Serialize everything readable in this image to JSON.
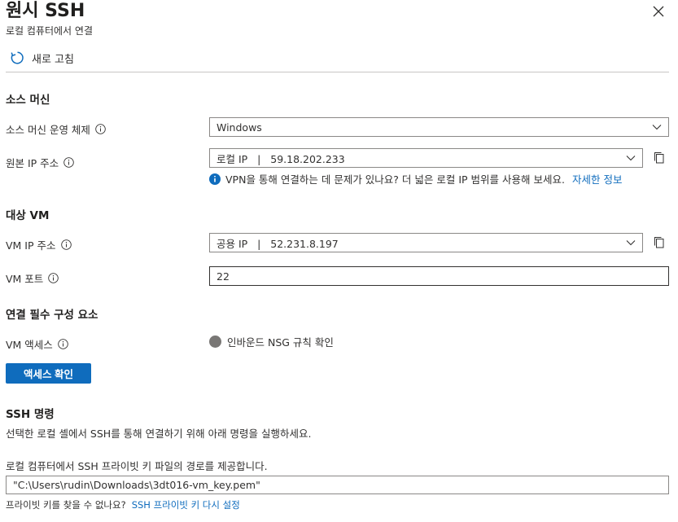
{
  "header": {
    "title": "원시 SSH",
    "subtitle": "로컬 컴퓨터에서 연결",
    "close_icon": "close-icon"
  },
  "toolbar": {
    "refresh_label": "새로 고침",
    "refresh_icon": "refresh-icon"
  },
  "source": {
    "heading": "소스 머신",
    "os_label": "소스 머신 운영 체제",
    "os_value": "Windows",
    "ip_label": "원본 IP 주소",
    "ip_value": "로컬 IP   |   59.18.202.233",
    "info_text": "VPN을 통해 연결하는 데 문제가 있나요? 더 넓은 로컬 IP 범위를 사용해 보세요.",
    "info_link": "자세한 정보"
  },
  "target": {
    "heading": "대상 VM",
    "vm_ip_label": "VM IP 주소",
    "vm_ip_value": "공용 IP   |   52.231.8.197",
    "vm_port_label": "VM 포트",
    "vm_port_value": "22"
  },
  "prereq": {
    "heading": "연결 필수 구성 요소",
    "vm_access_label": "VM 액세스",
    "status_text": "인바운드 NSG 규칙 확인",
    "status_color": "#797775",
    "check_button": "액세스 확인"
  },
  "ssh": {
    "heading": "SSH 명령",
    "desc": "선택한 로컬 셸에서 SSH를 통해 연결하기 위해 아래 명령을 실행하세요.",
    "key_path_label": "로컬 컴퓨터에서 SSH 프라이빗 키 파일의 경로를 제공합니다.",
    "key_path_value": "\"C:\\Users\\rudin\\Downloads\\3dt016-vm_key.pem\"",
    "footer_text": "프라이빗 키를 찾을 수 없나요?",
    "footer_link": "SSH 프라이빗 키 다시 설정"
  },
  "colors": {
    "accent": "#0f6cbd",
    "text": "#323130"
  }
}
